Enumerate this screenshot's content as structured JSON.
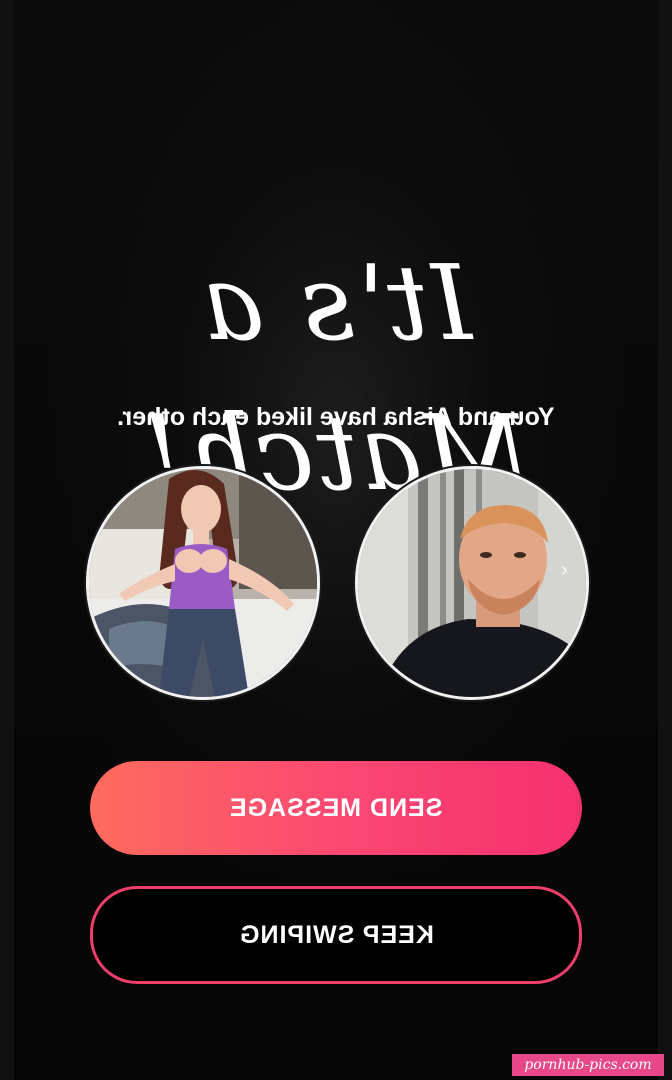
{
  "match": {
    "title": "It's a Match!",
    "subtitle": "You and Aisha have liked each other."
  },
  "avatars": {
    "left_label": "Aisha profile photo",
    "right_label": "Your profile photo",
    "next_icon": "chevron-right-icon",
    "next_glyph": "›"
  },
  "actions": {
    "send_message_label": "SEND MESSAGE",
    "keep_swiping_label": "KEEP SWIPING"
  },
  "watermark": {
    "text": "pornhub-pics.com"
  },
  "colors": {
    "background": "#050505",
    "send_gradient_start": "#fd6b5d",
    "send_gradient_end": "#f5306f",
    "keep_border": "#ee3e6a",
    "watermark_bg": "#e8488a"
  },
  "rendering": {
    "mirrored": true
  }
}
